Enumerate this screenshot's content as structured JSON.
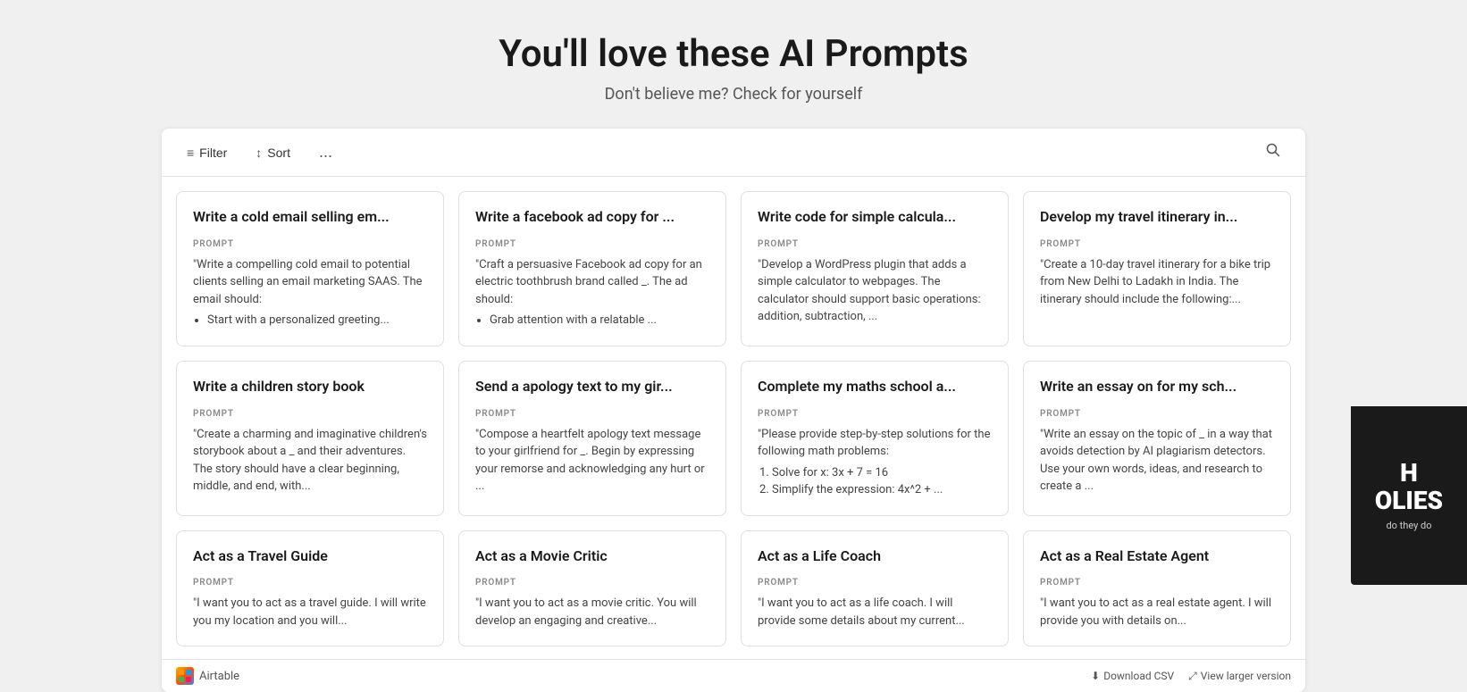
{
  "header": {
    "title": "You'll love these AI Prompts",
    "subtitle": "Don't believe me? Check for yourself"
  },
  "toolbar": {
    "filter_label": "Filter",
    "sort_label": "Sort",
    "more_label": "...",
    "filter_icon": "≡",
    "sort_icon": "↕"
  },
  "cards": [
    {
      "title": "Write a cold email selling em...",
      "label": "PROMPT",
      "body": "\"Write a compelling cold email to potential clients selling an email marketing SAAS. The email should:",
      "list_type": "bullet",
      "list_items": [
        "Start with a personalized greeting..."
      ]
    },
    {
      "title": "Write a facebook ad copy for ...",
      "label": "PROMPT",
      "body": "\"Craft a persuasive Facebook ad copy for an electric toothbrush brand called _. The ad should:",
      "list_type": "bullet",
      "list_items": [
        "Grab attention with a relatable ..."
      ]
    },
    {
      "title": "Write code for simple calcula...",
      "label": "PROMPT",
      "body": "\"Develop a WordPress plugin that adds a simple calculator to webpages. The calculator should support basic operations: addition, subtraction, ..."
    },
    {
      "title": "Develop my travel itinerary in...",
      "label": "PROMPT",
      "body": "\"Create a 10-day travel itinerary for a bike trip from New Delhi to Ladakh in India. The itinerary should include the following:..."
    },
    {
      "title": "Write a children story book",
      "label": "PROMPT",
      "body": "\"Create a charming and imaginative children's storybook about a _ and their adventures. The story should have a clear beginning, middle, and end, with..."
    },
    {
      "title": "Send a apology text to my gir...",
      "label": "PROMPT",
      "body": "\"Compose a heartfelt apology text message to your girlfriend for _. Begin by expressing your remorse and acknowledging any hurt or ..."
    },
    {
      "title": "Complete my maths school a...",
      "label": "PROMPT",
      "body": "\"Please provide step-by-step solutions for the following math problems:",
      "list_type": "ordered",
      "list_items": [
        "Solve for x: 3x + 7 = 16",
        "Simplify the expression: 4x^2 + ..."
      ]
    },
    {
      "title": "Write an essay on for my sch...",
      "label": "PROMPT",
      "body": "\"Write an essay on the topic of _ in a way that avoids detection by AI plagiarism detectors. Use your own words, ideas, and research to create a ..."
    },
    {
      "title": "Act as a Travel Guide",
      "label": "PROMPT",
      "body": "\"I want you to act as a travel guide. I will write you my location and you will..."
    },
    {
      "title": "Act as a Movie Critic",
      "label": "PROMPT",
      "body": "\"I want you to act as a movie critic. You will develop an engaging and creative..."
    },
    {
      "title": "Act as a Life Coach",
      "label": "PROMPT",
      "body": "\"I want you to act as a life coach. I will provide some details about my current..."
    },
    {
      "title": "Act as a Real Estate Agent",
      "label": "PROMPT",
      "body": "\"I want you to act as a real estate agent. I will provide you with details on..."
    }
  ],
  "bottom_bar": {
    "brand_name": "Airtable",
    "download_csv": "Download CSV",
    "view_larger": "View larger version"
  },
  "side_ad": {
    "line1": "H",
    "line2": "OLIES",
    "sub": "do they do"
  }
}
